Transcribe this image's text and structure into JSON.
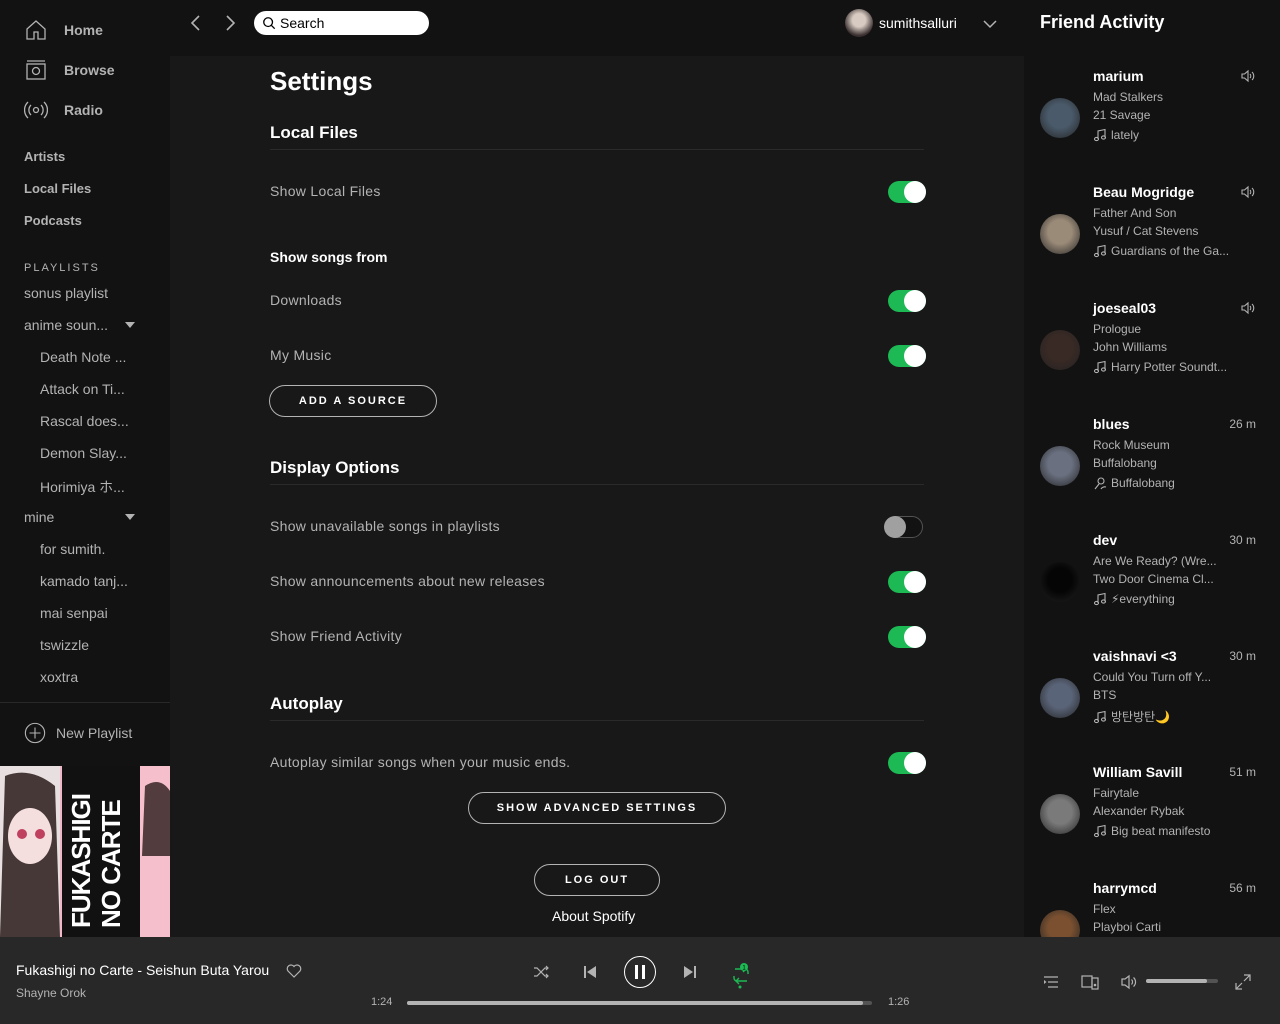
{
  "sidebar": {
    "nav": [
      {
        "label": "Home",
        "icon": "home-icon"
      },
      {
        "label": "Browse",
        "icon": "browse-icon"
      },
      {
        "label": "Radio",
        "icon": "radio-icon"
      }
    ],
    "library": [
      "Artists",
      "Local Files",
      "Podcasts"
    ],
    "playlists_header": "PLAYLISTS",
    "playlists": {
      "sonus": "sonus playlist",
      "anime_folder": "anime soun...",
      "anime_items": [
        "Death Note ...",
        "Attack on Ti...",
        "Rascal does...",
        "Demon Slay...",
        "Horimiya ホ..."
      ],
      "mine_folder": "mine",
      "mine_items": [
        "for sumith.",
        "kamado tanj...",
        "mai senpai",
        "tswizzle",
        "xoxtra"
      ]
    },
    "new_playlist": "New Playlist",
    "album_art_text": "FUKASHIGI NO CARTE"
  },
  "topbar": {
    "search_placeholder": "Search",
    "username": "sumithsalluri"
  },
  "settings": {
    "title": "Settings",
    "local_files": {
      "title": "Local Files",
      "show_local_files": {
        "label": "Show Local Files",
        "on": true
      },
      "show_songs_from": "Show songs from",
      "downloads": {
        "label": "Downloads",
        "on": true
      },
      "my_music": {
        "label": "My Music",
        "on": true
      },
      "add_source": "ADD A SOURCE"
    },
    "display": {
      "title": "Display Options",
      "unavailable": {
        "label": "Show unavailable songs in playlists",
        "on": false
      },
      "announcements": {
        "label": "Show announcements about new releases",
        "on": true
      },
      "friend_activity": {
        "label": "Show Friend Activity",
        "on": true
      }
    },
    "autoplay": {
      "title": "Autoplay",
      "similar": {
        "label": "Autoplay similar songs when your music ends.",
        "on": true
      }
    },
    "advanced": "SHOW ADVANCED SETTINGS",
    "logout": "LOG OUT",
    "about": "About Spotify"
  },
  "friends": {
    "title": "Friend Activity",
    "list": [
      {
        "name": "marium",
        "time": "",
        "listening": true,
        "track": "Mad Stalkers",
        "artist": "21 Savage",
        "context": "lately",
        "ctx_icon": "note",
        "avatar": "#4a5a6a"
      },
      {
        "name": "Beau Mogridge",
        "time": "",
        "listening": true,
        "track": "Father And Son",
        "artist": "Yusuf / Cat Stevens",
        "context": "Guardians of the Ga...",
        "ctx_icon": "note",
        "avatar": "#9a8a78"
      },
      {
        "name": "joeseal03",
        "time": "",
        "listening": true,
        "track": "Prologue",
        "artist": "John Williams",
        "context": "Harry Potter Soundt...",
        "ctx_icon": "note",
        "avatar": "#3a2a25"
      },
      {
        "name": "blues",
        "time": "26 m",
        "listening": false,
        "track": "Rock Museum",
        "artist": "Buffalobang",
        "context": "Buffalobang",
        "ctx_icon": "artist",
        "avatar": "#6a7080"
      },
      {
        "name": "dev",
        "time": "30 m",
        "listening": false,
        "track": "Are We Ready? (Wre...",
        "artist": "Two Door Cinema Cl...",
        "context": "⚡everything",
        "ctx_icon": "note",
        "avatar": "#050505"
      },
      {
        "name": "vaishnavi <3",
        "time": "30 m",
        "listening": false,
        "track": "Could You Turn off Y...",
        "artist": "BTS",
        "context": "방탄방탄🌙",
        "ctx_icon": "note",
        "avatar": "#5a6478"
      },
      {
        "name": "William Savill",
        "time": "51 m",
        "listening": false,
        "track": "Fairytale",
        "artist": "Alexander Rybak",
        "context": "Big beat manifesto",
        "ctx_icon": "note",
        "avatar": "#7a7a7a"
      },
      {
        "name": "harrymcd",
        "time": "56 m",
        "listening": false,
        "track": "Flex",
        "artist": "Playboi Carti",
        "context": "",
        "ctx_icon": "note",
        "avatar": "#7a5030"
      }
    ]
  },
  "player": {
    "track": "Fukashigi no Carte - Seishun Buta Yarou",
    "artist": "Shayne Orok",
    "elapsed": "1:24",
    "total": "1:26",
    "progress": 0.98,
    "volume": 0.85,
    "repeat_badge": "1"
  },
  "colors": {
    "accent": "#1db954",
    "bg": "#121212",
    "main_bg": "#181818",
    "player_bg": "#282828"
  }
}
